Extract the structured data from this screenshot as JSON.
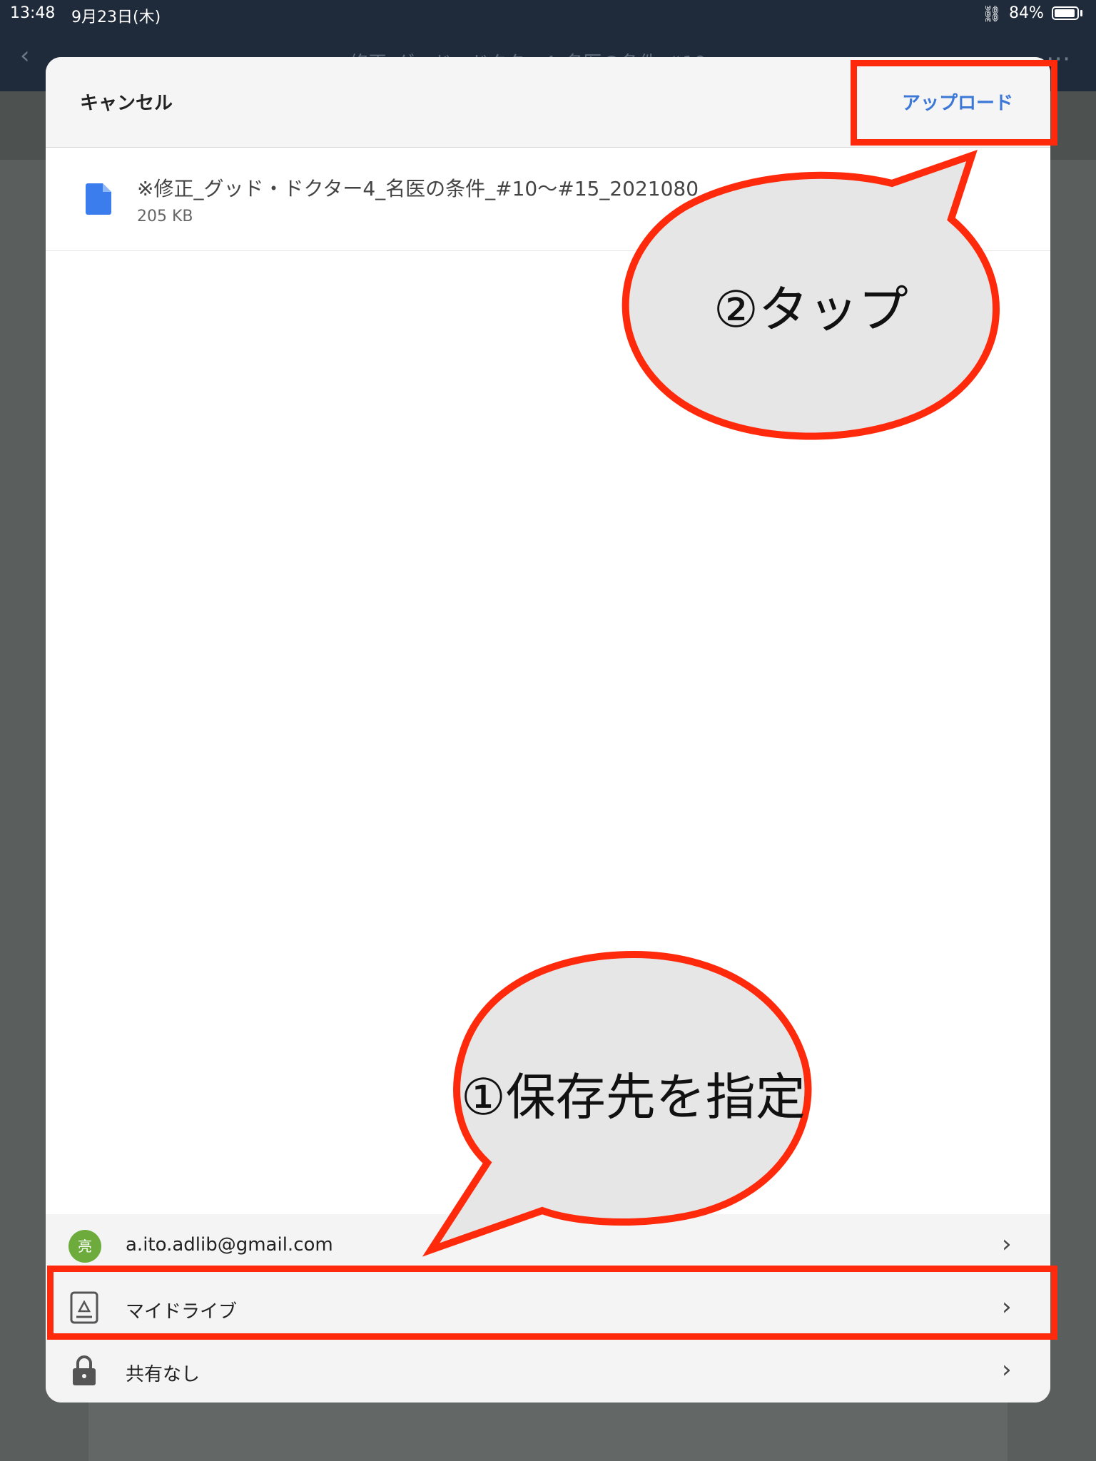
{
  "status_bar": {
    "time": "13:48",
    "date": "9月23日(木)",
    "battery": "84%"
  },
  "background_app": {
    "title": "修正_グッド・ドクター4_名医の条件_#10"
  },
  "sheet": {
    "cancel_label": "キャンセル",
    "upload_label": "アップロード",
    "file": {
      "name": "※修正_グッド・ドクター4_名医の条件_#10〜#15_2021080",
      "size": "205 KB"
    },
    "destinations": [
      {
        "avatar_text": "亮",
        "label": "a.ito.adlib@gmail.com",
        "icon": "account-avatar"
      },
      {
        "label": "マイドライブ",
        "icon": "drive-icon"
      },
      {
        "label": "共有なし",
        "icon": "lock-icon"
      }
    ]
  },
  "annotations": {
    "bubble_tap": "②タップ",
    "bubble_dest": "①保存先を指定"
  },
  "colors": {
    "annotation_red": "#ff2a0c",
    "accent_blue": "#3b78d8",
    "bubble_fill": "#e6e6e6"
  }
}
